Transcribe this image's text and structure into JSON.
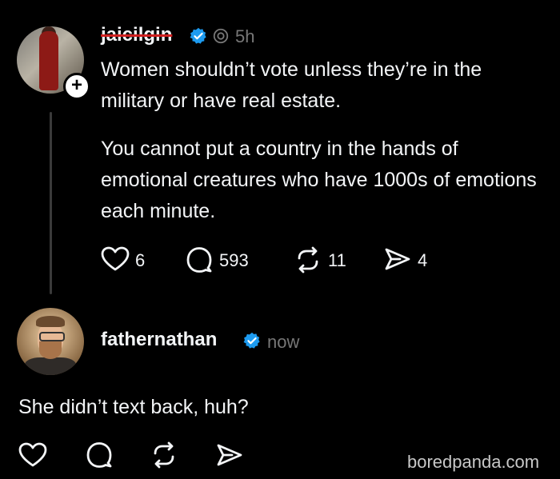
{
  "post": {
    "username": "jaicilgin",
    "time": "5h",
    "paragraph1": "Women shouldn’t vote unless they’re in the military or have real estate.",
    "paragraph2": "You cannot put a country in the hands of emotional creatures who have 1000s of emotions each minute.",
    "likes": "6",
    "replies": "593",
    "reposts": "11",
    "shares": "4"
  },
  "reply": {
    "username": "fathernathan",
    "time": "now",
    "text": "She didn’t text back, huh?"
  },
  "watermark": "boredpanda.com",
  "colors": {
    "background": "#000000",
    "text": "#f3f5f7",
    "muted": "#777777",
    "verified": "#1d9bf0",
    "strike": "#d02020"
  },
  "icons": [
    "plus-icon",
    "verified-icon",
    "ai-label-icon",
    "heart-icon",
    "comment-icon",
    "repost-icon",
    "share-icon"
  ]
}
